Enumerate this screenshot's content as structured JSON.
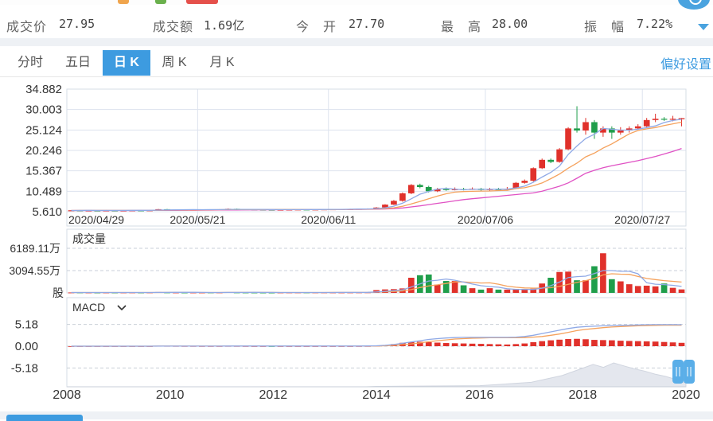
{
  "quote": {
    "price_label": "成交价",
    "price_value": "27.95",
    "amount_label": "成交额",
    "amount_value": "1.69亿",
    "open_label": "今　开",
    "open_value": "27.70",
    "high_label": "最　高",
    "high_value": "28.00",
    "amplitude_label": "振　幅",
    "amplitude_value": "7.22%"
  },
  "tabs": [
    {
      "label": "分时"
    },
    {
      "label": "五日"
    },
    {
      "label": "日 K"
    },
    {
      "label": "周 K"
    },
    {
      "label": "月 K"
    }
  ],
  "active_tab": "日 K",
  "preference_label": "偏好设置",
  "colors": {
    "up": "#e0312b",
    "down": "#1f9e4b",
    "ma5": "#8fa9e6",
    "ma10": "#f5a25d",
    "ma20": "#e052c4",
    "accent": "#3d9be0"
  },
  "chart_data": [
    {
      "type": "candlestick",
      "panel": "price",
      "y_ticks": [
        "34.882",
        "30.003",
        "25.124",
        "20.246",
        "15.367",
        "10.489",
        "5.610"
      ],
      "ylim": [
        5.61,
        34.882
      ],
      "x_ticks": [
        "2020/04/29",
        "2020/05/21",
        "2020/06/11",
        "2020/07/06",
        "2020/07/27"
      ],
      "candles": [
        [
          5.9,
          5.95,
          6.0,
          5.85
        ],
        [
          5.95,
          5.9,
          6.0,
          5.85
        ],
        [
          5.9,
          5.92,
          5.98,
          5.85
        ],
        [
          5.92,
          5.9,
          5.98,
          5.86
        ],
        [
          5.9,
          5.93,
          6.0,
          5.86
        ],
        [
          5.93,
          5.9,
          5.98,
          5.86
        ],
        [
          5.9,
          5.92,
          5.97,
          5.86
        ],
        [
          5.92,
          5.95,
          6.0,
          5.88
        ],
        [
          5.95,
          5.93,
          6.0,
          5.88
        ],
        [
          5.93,
          5.96,
          6.02,
          5.9
        ],
        [
          5.96,
          6.2,
          6.25,
          5.92
        ],
        [
          6.2,
          6.05,
          6.25,
          6.0
        ],
        [
          6.05,
          6.1,
          6.15,
          6.0
        ],
        [
          6.1,
          6.05,
          6.15,
          6.0
        ],
        [
          6.05,
          6.1,
          6.15,
          6.0
        ],
        [
          6.1,
          6.12,
          6.18,
          6.05
        ],
        [
          6.12,
          6.1,
          6.18,
          6.05
        ],
        [
          6.1,
          6.15,
          6.2,
          6.05
        ],
        [
          6.15,
          6.3,
          6.4,
          6.1
        ],
        [
          6.3,
          6.2,
          6.35,
          6.15
        ],
        [
          6.2,
          6.15,
          6.25,
          6.1
        ],
        [
          6.15,
          6.12,
          6.2,
          6.08
        ],
        [
          6.12,
          6.1,
          6.18,
          6.05
        ],
        [
          6.1,
          6.08,
          6.15,
          6.03
        ],
        [
          6.08,
          6.1,
          6.15,
          6.03
        ],
        [
          6.1,
          6.12,
          6.18,
          6.05
        ],
        [
          6.12,
          6.15,
          6.2,
          6.08
        ],
        [
          6.15,
          6.12,
          6.2,
          6.08
        ],
        [
          6.12,
          6.15,
          6.2,
          6.08
        ],
        [
          6.15,
          6.18,
          6.22,
          6.1
        ],
        [
          6.18,
          6.2,
          6.25,
          6.12
        ],
        [
          6.2,
          6.22,
          6.28,
          6.15
        ],
        [
          6.22,
          6.25,
          6.3,
          6.18
        ],
        [
          6.25,
          6.3,
          6.35,
          6.2
        ],
        [
          6.3,
          6.32,
          6.4,
          6.25
        ],
        [
          6.32,
          6.6,
          6.7,
          6.3
        ],
        [
          6.6,
          7.3,
          7.4,
          6.5
        ],
        [
          7.3,
          8.2,
          8.4,
          7.2
        ],
        [
          8.2,
          10.0,
          10.2,
          8.0
        ],
        [
          10.0,
          12.0,
          12.2,
          9.8
        ],
        [
          12.0,
          11.5,
          12.3,
          11.2
        ],
        [
          11.5,
          10.5,
          11.8,
          10.2
        ],
        [
          10.5,
          11.0,
          11.3,
          10.3
        ],
        [
          11.0,
          10.8,
          11.4,
          10.6
        ],
        [
          10.8,
          11.0,
          11.4,
          10.7
        ],
        [
          11.0,
          10.9,
          11.3,
          10.7
        ],
        [
          10.9,
          11.1,
          11.4,
          10.8
        ],
        [
          11.1,
          10.8,
          11.3,
          10.6
        ],
        [
          10.8,
          11.0,
          11.3,
          10.6
        ],
        [
          11.0,
          10.9,
          11.3,
          10.7
        ],
        [
          10.9,
          11.1,
          11.5,
          10.8
        ],
        [
          11.1,
          12.5,
          12.7,
          11.0
        ],
        [
          12.5,
          13.0,
          13.3,
          12.3
        ],
        [
          13.0,
          16.0,
          16.2,
          12.8
        ],
        [
          16.0,
          18.0,
          18.3,
          15.8
        ],
        [
          18.0,
          17.5,
          18.3,
          17.2
        ],
        [
          17.5,
          20.5,
          20.8,
          17.3
        ],
        [
          20.5,
          25.5,
          25.8,
          20.3
        ],
        [
          25.5,
          25.0,
          30.8,
          24.5
        ],
        [
          25.0,
          27.0,
          28.0,
          24.0
        ],
        [
          27.0,
          24.5,
          27.5,
          23.0
        ],
        [
          24.5,
          25.5,
          26.0,
          23.5
        ],
        [
          25.5,
          24.5,
          26.0,
          23.0
        ],
        [
          24.5,
          25.0,
          25.8,
          24.0
        ],
        [
          25.0,
          25.5,
          26.0,
          24.5
        ],
        [
          25.5,
          26.0,
          26.5,
          25.2
        ],
        [
          26.0,
          27.5,
          28.0,
          25.8
        ],
        [
          27.5,
          27.8,
          29.0,
          27.0
        ],
        [
          27.8,
          27.6,
          28.2,
          27.3
        ],
        [
          27.6,
          27.8,
          28.5,
          27.2
        ],
        [
          27.7,
          27.95,
          28.0,
          26.0
        ]
      ],
      "ma5": [
        5.9,
        5.92,
        5.93,
        5.92,
        5.92,
        5.92,
        5.92,
        5.93,
        5.93,
        5.94,
        5.99,
        6.02,
        6.05,
        6.08,
        6.1,
        6.09,
        6.1,
        6.11,
        6.16,
        6.17,
        6.17,
        6.17,
        6.16,
        6.13,
        6.11,
        6.11,
        6.11,
        6.12,
        6.13,
        6.14,
        6.16,
        6.17,
        6.2,
        6.24,
        6.26,
        6.34,
        6.53,
        6.92,
        7.65,
        8.68,
        9.8,
        10.44,
        11.0,
        11.16,
        11.0,
        10.84,
        10.96,
        10.96,
        10.96,
        10.98,
        10.98,
        11.28,
        11.72,
        12.62,
        13.88,
        15.0,
        16.5,
        19.3,
        21.3,
        23.1,
        24.1,
        25.5,
        25.3,
        25.1,
        25.1,
        25.3,
        25.7,
        26.1,
        26.9,
        27.4,
        27.7
      ],
      "ma10": [
        5.9,
        5.91,
        5.91,
        5.91,
        5.91,
        5.91,
        5.91,
        5.91,
        5.92,
        5.92,
        5.95,
        5.97,
        5.99,
        6.0,
        6.01,
        6.05,
        6.07,
        6.08,
        6.11,
        6.13,
        6.13,
        6.13,
        6.13,
        6.14,
        6.14,
        6.14,
        6.14,
        6.14,
        6.13,
        6.13,
        6.13,
        6.14,
        6.16,
        6.18,
        6.2,
        6.25,
        6.35,
        6.55,
        6.9,
        7.47,
        8.07,
        8.68,
        9.33,
        9.88,
        10.28,
        10.42,
        10.47,
        10.53,
        10.56,
        10.64,
        10.71,
        11.12,
        11.33,
        11.8,
        12.48,
        13.5,
        14.6,
        16.0,
        17.2,
        18.7,
        19.6,
        20.8,
        21.8,
        23.0,
        24.2,
        25.0,
        25.4,
        25.7,
        26.2,
        26.6,
        27.0
      ],
      "ma20": [
        5.9,
        5.9,
        5.9,
        5.9,
        5.9,
        5.9,
        5.9,
        5.9,
        5.91,
        5.91,
        5.92,
        5.93,
        5.94,
        5.95,
        5.96,
        5.98,
        5.99,
        6.0,
        6.02,
        6.03,
        6.04,
        6.05,
        6.06,
        6.07,
        6.08,
        6.09,
        6.1,
        6.11,
        6.12,
        6.13,
        6.14,
        6.15,
        6.16,
        6.17,
        6.18,
        6.21,
        6.26,
        6.35,
        6.5,
        6.75,
        7.0,
        7.3,
        7.6,
        7.9,
        8.2,
        8.5,
        8.7,
        8.9,
        9.1,
        9.3,
        9.5,
        9.7,
        9.9,
        10.1,
        10.5,
        11.1,
        11.7,
        12.5,
        13.6,
        14.8,
        15.5,
        16.1,
        16.6,
        17.0,
        17.4,
        17.8,
        18.3,
        18.8,
        19.4,
        20.0,
        20.7
      ]
    },
    {
      "type": "bar",
      "panel": "volume",
      "title": "成交量",
      "y_ticks": [
        "6189.11万",
        "3094.55万",
        "股"
      ],
      "ylim": [
        0,
        6189.11
      ],
      "unit": "万股",
      "values": [
        60,
        55,
        50,
        45,
        50,
        48,
        52,
        55,
        50,
        60,
        120,
        70,
        60,
        55,
        58,
        52,
        55,
        58,
        110,
        70,
        60,
        55,
        52,
        50,
        52,
        55,
        58,
        55,
        58,
        60,
        62,
        65,
        70,
        75,
        80,
        380,
        480,
        520,
        620,
        2100,
        2450,
        2550,
        1150,
        1650,
        1650,
        1050,
        650,
        450,
        650,
        450,
        450,
        450,
        450,
        580,
        1300,
        2100,
        2900,
        2950,
        1750,
        1750,
        3700,
        5500,
        1900,
        1600,
        1200,
        950,
        1000,
        900,
        1300,
        700,
        480
      ],
      "ma5": [
        60,
        58,
        55,
        52,
        52,
        50,
        51,
        51,
        51,
        53,
        65,
        71,
        75,
        77,
        80,
        63,
        60,
        58,
        67,
        70,
        71,
        72,
        70,
        64,
        56,
        53,
        53,
        54,
        56,
        57,
        59,
        61,
        64,
        68,
        72,
        138,
        219,
        305,
        416,
        820,
        1254,
        1644,
        1758,
        1920,
        1762,
        1490,
        1230,
        990,
        870,
        780,
        580,
        490,
        470,
        480,
        650,
        1000,
        1500,
        2130,
        2250,
        2320,
        2680,
        3100,
        3100,
        3000,
        3000,
        2650,
        1400,
        1200,
        1150,
        1050,
        900
      ],
      "ma10": [
        60,
        59,
        57,
        55,
        55,
        54,
        54,
        54,
        53,
        53,
        59,
        61,
        63,
        64,
        66,
        59,
        57,
        57,
        62,
        64,
        65,
        64,
        63,
        61,
        60,
        59,
        59,
        59,
        60,
        60,
        61,
        62,
        63,
        64,
        66,
        106,
        151,
        200,
        260,
        456,
        745,
        960,
        1120,
        1300,
        1520,
        1510,
        1450,
        1370,
        1390,
        1210,
        930,
        780,
        680,
        660,
        670,
        720,
        900,
        1180,
        1450,
        1700,
        2000,
        2500,
        2650,
        2600,
        2580,
        2280,
        2000,
        1850,
        1700,
        1600,
        1500
      ]
    },
    {
      "type": "bar",
      "panel": "macd",
      "title": "MACD",
      "y_ticks": [
        "5.18",
        "0.00",
        "-5.18"
      ],
      "ylim": [
        -7.0,
        7.0
      ],
      "histogram": [
        0,
        0,
        0,
        0,
        0,
        0,
        0,
        0,
        0,
        0,
        0.05,
        0.04,
        0.03,
        0.02,
        0.02,
        0.01,
        0.01,
        0.01,
        0.03,
        0.02,
        0.01,
        0,
        0,
        -0.01,
        0,
        0,
        0,
        0,
        0,
        0,
        0,
        0,
        0,
        0.01,
        0.02,
        0.1,
        0.25,
        0.5,
        0.8,
        1.0,
        1.05,
        0.95,
        0.85,
        0.75,
        0.7,
        0.65,
        0.6,
        0.55,
        0.5,
        0.45,
        0.4,
        0.5,
        0.65,
        0.95,
        1.2,
        1.4,
        1.55,
        1.7,
        1.75,
        1.65,
        1.5,
        1.45,
        1.4,
        1.3,
        1.25,
        1.2,
        1.15,
        1.1,
        1.0,
        0.9,
        0.8
      ],
      "dif": [
        0,
        0,
        0,
        0,
        0,
        0,
        0,
        0,
        0,
        0,
        0.02,
        0.02,
        0.02,
        0.02,
        0.02,
        0.02,
        0.02,
        0.02,
        0.03,
        0.03,
        0.03,
        0.03,
        0.03,
        0.03,
        0.03,
        0.03,
        0.03,
        0.03,
        0.03,
        0.03,
        0.03,
        0.03,
        0.03,
        0.04,
        0.05,
        0.1,
        0.2,
        0.4,
        0.7,
        1.0,
        1.3,
        1.6,
        1.8,
        1.95,
        2.05,
        2.1,
        2.1,
        2.1,
        2.1,
        2.1,
        2.1,
        2.15,
        2.3,
        2.6,
        3.0,
        3.4,
        3.8,
        4.2,
        4.5,
        4.65,
        4.75,
        4.85,
        4.9,
        4.95,
        5.0,
        5.05,
        5.1,
        5.12,
        5.12,
        5.12,
        5.1
      ],
      "dea": [
        0,
        0,
        0,
        0,
        0,
        0,
        0,
        0,
        0,
        0,
        0.01,
        0.01,
        0.01,
        0.01,
        0.01,
        0.01,
        0.01,
        0.01,
        0.02,
        0.02,
        0.02,
        0.02,
        0.02,
        0.02,
        0.02,
        0.02,
        0.02,
        0.02,
        0.02,
        0.02,
        0.02,
        0.02,
        0.02,
        0.02,
        0.03,
        0.05,
        0.1,
        0.2,
        0.35,
        0.55,
        0.8,
        1.05,
        1.3,
        1.5,
        1.7,
        1.8,
        1.9,
        1.95,
        2.0,
        2.0,
        2.0,
        2.0,
        2.05,
        2.15,
        2.3,
        2.6,
        2.9,
        3.3,
        3.7,
        4.0,
        4.2,
        4.4,
        4.55,
        4.65,
        4.75,
        4.85,
        4.9,
        4.95,
        5.0,
        5.0,
        5.0
      ]
    },
    {
      "type": "area",
      "panel": "overview",
      "x_ticks": [
        "2008",
        "2010",
        "2012",
        "2014",
        "2016",
        "2018",
        "2020"
      ],
      "xlim": [
        2008,
        2020
      ],
      "window": [
        2019.8,
        2020
      ],
      "x": [
        2008,
        2013.8,
        2014,
        2016,
        2017,
        2017.6,
        2018,
        2018.2,
        2018.4,
        2018.6,
        2018.8,
        2019,
        2019.2,
        2019.4,
        2019.6,
        2019.8,
        2020
      ],
      "values": [
        0,
        0,
        0.05,
        0.15,
        0.6,
        1.5,
        2.5,
        3.0,
        2.6,
        3.2,
        2.8,
        2.4,
        2.1,
        1.7,
        1.4,
        1.0,
        0.5
      ]
    }
  ]
}
